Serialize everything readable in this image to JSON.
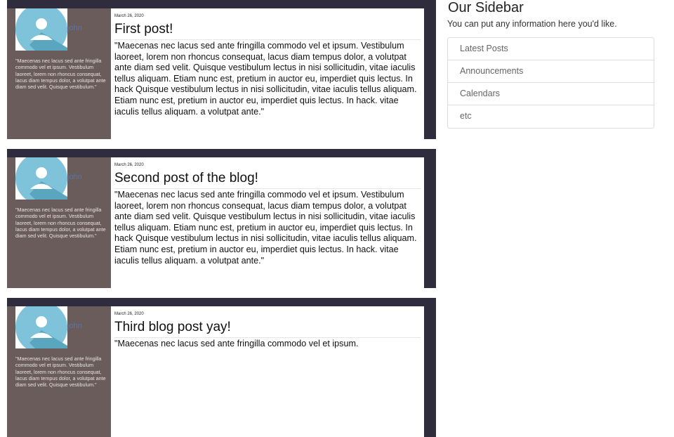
{
  "posts": [
    {
      "date": "March 26, 2020",
      "title": "First post!",
      "author_link": "john",
      "author_bio": "\"Maecenas nec lacus sed ante fringilla commodo vel et ipsum. Vestibulum laoreet, lorem non rhoncus consequat, lacus diam tempus dolor, a volutpat ante diam sed velit. Quisque vestibulum.\"",
      "body": "\"Maecenas nec lacus sed ante fringilla commodo vel et ipsum. Vestibulum laoreet, lorem non rhoncus consequat, lacus diam tempus dolor, a volutpat ante diam sed velit. Quisque vestibulum lectus in nisi sollicitudin, vitae iaculis tellus aliquam. Etiam nunc est, pretium in auctor eu, imperdiet quis lectus. In hack Quisque vestibulum lectus in nisi sollicitudin, vitae iaculis tellus aliquam. Etiam nunc est, pretium in auctor eu, imperdiet quis lectus. In hack. vitae iaculis tellus aliquam. a volutpat ante.\""
    },
    {
      "date": "March 26, 2020",
      "title": "Second post of the blog!",
      "author_link": "john",
      "author_bio": "\"Maecenas nec lacus sed ante fringilla commodo vel et ipsum. Vestibulum laoreet, lorem non rhoncus consequat, lacus diam tempus dolor, a volutpat ante diam sed velit. Quisque vestibulum.\"",
      "body": "\"Maecenas nec lacus sed ante fringilla commodo vel et ipsum. Vestibulum laoreet, lorem non rhoncus consequat, lacus diam tempus dolor, a volutpat ante diam sed velit. Quisque vestibulum lectus in nisi sollicitudin, vitae iaculis tellus aliquam. Etiam nunc est, pretium in auctor eu, imperdiet quis lectus. In hack Quisque vestibulum lectus in nisi sollicitudin, vitae iaculis tellus aliquam. Etiam nunc est, pretium in auctor eu, imperdiet quis lectus. In hack. vitae iaculis tellus aliquam. a volutpat ante.\""
    },
    {
      "date": "March 26, 2020",
      "title": "Third blog post yay!",
      "author_link": "john",
      "author_bio": "\"Maecenas nec lacus sed ante fringilla commodo vel et ipsum. Vestibulum laoreet, lorem non rhoncus consequat, lacus diam tempus dolor, a volutpat ante diam sed velit. Quisque vestibulum.\"",
      "body": "\"Maecenas nec lacus sed ante fringilla commodo vel et ipsum."
    }
  ],
  "sidebar": {
    "title": "Our Sidebar",
    "description": "You can put any information here you'd like.",
    "items": [
      "Latest Posts",
      "Announcements",
      "Calendars",
      "etc"
    ]
  },
  "icons": {
    "avatar": "user-avatar-icon"
  },
  "colors": {
    "author_panel": "#6b5c5c",
    "post_frame": "#2f2c3d",
    "avatar_circle": "#7ec3d9",
    "link": "#3a7bd5"
  }
}
